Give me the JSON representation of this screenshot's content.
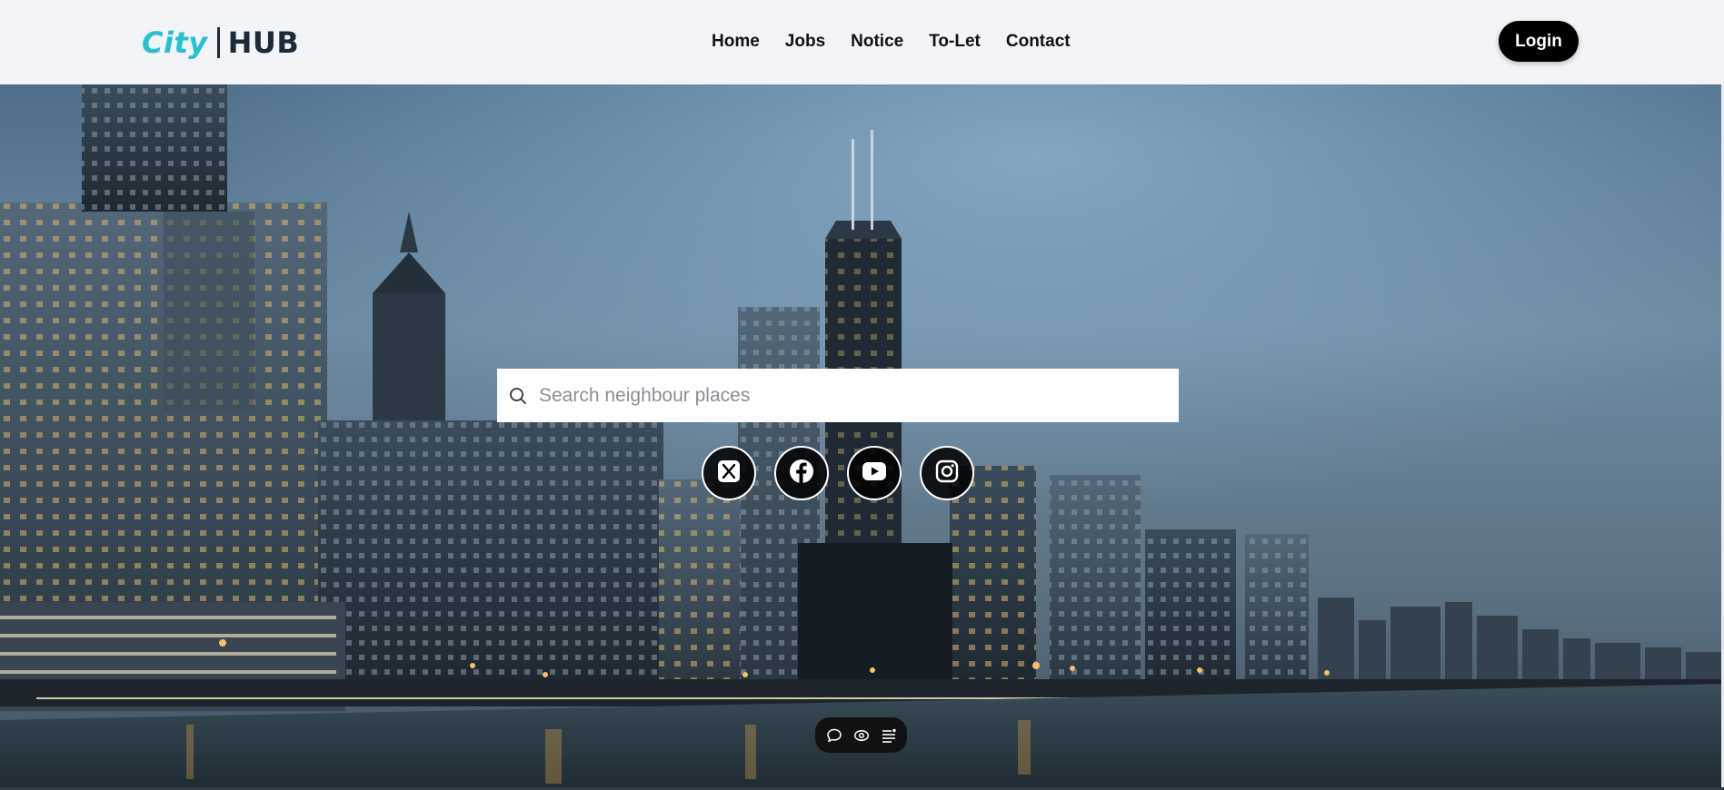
{
  "brand": {
    "city": "City",
    "hub": "HUB"
  },
  "nav": {
    "items": [
      {
        "label": "Home"
      },
      {
        "label": "Jobs"
      },
      {
        "label": "Notice"
      },
      {
        "label": "To-Let"
      },
      {
        "label": "Contact"
      }
    ]
  },
  "header": {
    "login_label": "Login"
  },
  "search": {
    "placeholder": "Search neighbour places",
    "value": ""
  },
  "socials": [
    {
      "icon": "x-twitter-icon"
    },
    {
      "icon": "facebook-icon"
    },
    {
      "icon": "youtube-icon"
    },
    {
      "icon": "instagram-icon"
    }
  ],
  "toolbar": {
    "icons": [
      "chat-bubble-icon",
      "eye-icon",
      "list-icon"
    ]
  },
  "colors": {
    "brand_accent": "#22c2cf",
    "brand_dark": "#1d2a3a",
    "header_bg": "#f2f4f7",
    "login_bg": "#000000"
  }
}
